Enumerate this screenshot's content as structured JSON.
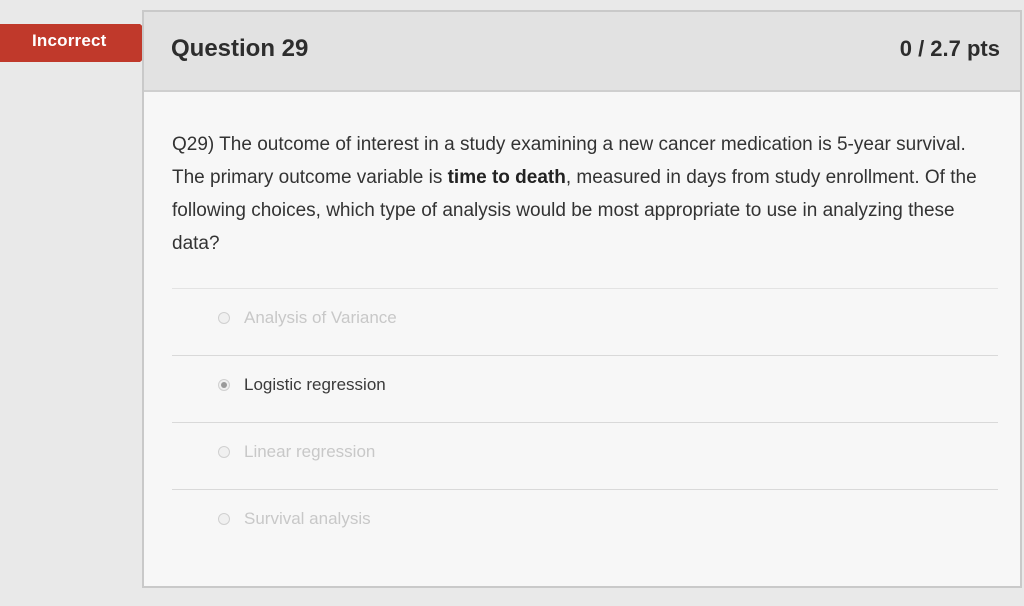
{
  "status_badge": "Incorrect",
  "question": {
    "title": "Question 29",
    "points": "0 / 2.7 pts",
    "text_before": "Q29) The outcome of interest in a study examining a new cancer medication is 5-year survival. The primary outcome variable is ",
    "text_bold": "time to death",
    "text_after": ", measured in days from study enrollment. Of the following choices, which type of analysis would be most appropriate to use in analyzing these data?"
  },
  "answers": [
    {
      "label": "Analysis of Variance",
      "selected": false
    },
    {
      "label": "Logistic regression",
      "selected": true
    },
    {
      "label": "Linear regression",
      "selected": false
    },
    {
      "label": "Survival analysis",
      "selected": false
    }
  ]
}
